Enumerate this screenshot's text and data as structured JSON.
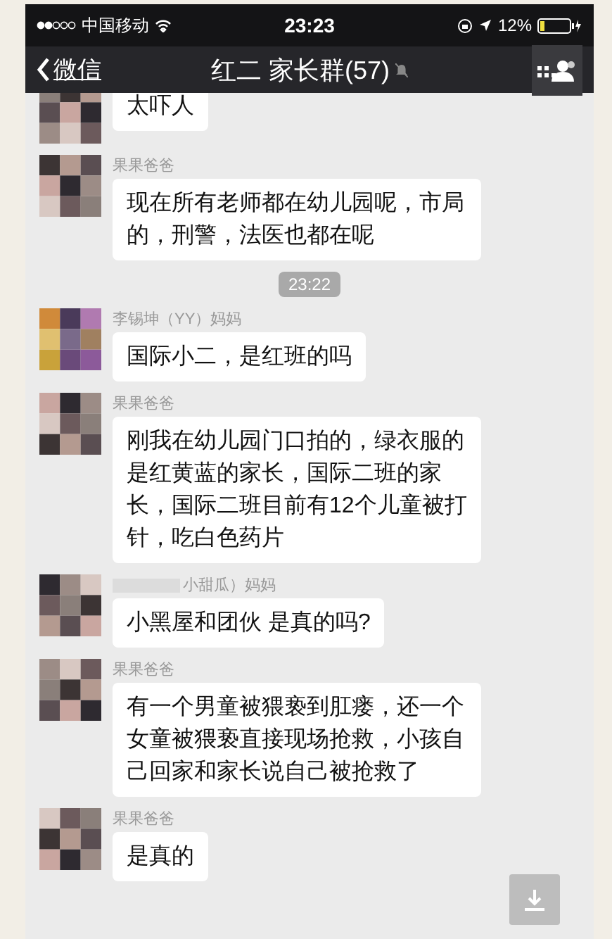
{
  "status_bar": {
    "carrier": "中国移动",
    "time": "23:23",
    "battery": "12%"
  },
  "nav": {
    "back": "微信",
    "title": "红二 家长群(57)",
    "muted": true
  },
  "messages": [
    {
      "kind": "message",
      "text": "太吓人"
    },
    {
      "kind": "message",
      "sender": "果果爸爸",
      "text": "现在所有老师都在幼儿园呢，市局的，刑警，法医也都在呢"
    },
    {
      "kind": "time",
      "text": "23:22"
    },
    {
      "kind": "message",
      "sender": "李锡坤（YY）妈妈",
      "text": "国际小二，是红班的吗"
    },
    {
      "kind": "message",
      "sender": "果果爸爸",
      "text": "刚我在幼儿园门口拍的，绿衣服的是红黄蓝的家长，国际二班的家长，国际二班目前有12个儿童被打针，吃白色药片"
    },
    {
      "kind": "message",
      "sender": "小甜瓜）妈妈",
      "redacted": true,
      "text": "小黑屋和团伙 是真的吗?"
    },
    {
      "kind": "message",
      "sender": "果果爸爸",
      "text": "有一个男童被猥亵到肛瘘，还一个女童被猥亵直接现场抢救，小孩自己回家和家长说自己被抢救了"
    },
    {
      "kind": "message",
      "sender": "果果爸爸",
      "text": "是真的"
    }
  ]
}
